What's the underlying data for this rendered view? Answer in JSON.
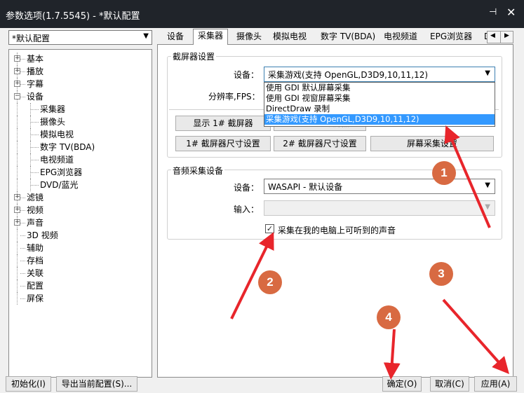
{
  "window": {
    "title": "参数选项(1.7.5545) - *默认配置",
    "pin_glyph": "⊣",
    "close_glyph": "✕"
  },
  "preset": {
    "value": "*默认配置"
  },
  "tree": [
    {
      "label": "基本",
      "expander": "+",
      "child": false
    },
    {
      "label": "播放",
      "expander": "+",
      "child": false
    },
    {
      "label": "字幕",
      "expander": "+",
      "child": false
    },
    {
      "label": "设备",
      "expander": "−",
      "child": false
    },
    {
      "label": "采集器",
      "expander": "",
      "child": true
    },
    {
      "label": "摄像头",
      "expander": "",
      "child": true
    },
    {
      "label": "模拟电视",
      "expander": "",
      "child": true
    },
    {
      "label": "数字 TV(BDA)",
      "expander": "",
      "child": true
    },
    {
      "label": "电视频道",
      "expander": "",
      "child": true
    },
    {
      "label": "EPG浏览器",
      "expander": "",
      "child": true
    },
    {
      "label": "DVD/蓝光",
      "expander": "",
      "child": true
    },
    {
      "label": "滤镜",
      "expander": "+",
      "child": false
    },
    {
      "label": "视频",
      "expander": "+",
      "child": false
    },
    {
      "label": "声音",
      "expander": "+",
      "child": false
    },
    {
      "label": "3D 视频",
      "expander": "",
      "child": false
    },
    {
      "label": "辅助",
      "expander": "",
      "child": false
    },
    {
      "label": "存档",
      "expander": "",
      "child": false
    },
    {
      "label": "关联",
      "expander": "",
      "child": false
    },
    {
      "label": "配置",
      "expander": "",
      "child": false
    },
    {
      "label": "屏保",
      "expander": "",
      "child": false
    }
  ],
  "tabs": [
    "设备",
    "采集器",
    "摄像头",
    "模拟电视",
    "数字 TV(BDA)",
    "电视频道",
    "EPG浏览器",
    "D"
  ],
  "tab_scroll": {
    "left": "◀",
    "right": "▶"
  },
  "screen": {
    "group_title": "截屏器设置",
    "device_label": "设备：",
    "device_value": "采集游戏(支持 OpenGL,D3D9,10,11,12)",
    "options": [
      "使用 GDI 默认屏幕采集",
      "使用 GDI 视窗屏幕采集",
      "DirectDraw 录制",
      "采集游戏(支持 OpenGL,D3D9,10,11,12)"
    ],
    "resolution_label": "分辨率,FPS：",
    "btn_show1": "显示 1# 截屏器",
    "btn_show2_partial": "显示 2# 截屏器",
    "btn_size1": "1# 截屏器尺寸设置",
    "btn_size2": "2# 截屏器尺寸设置",
    "btn_screen": "屏幕采集设置"
  },
  "audio": {
    "group_title": "音频采集设备",
    "device_label": "设备：",
    "device_value": "WASAPI - 默认设备",
    "input_label": "输入：",
    "input_value": "",
    "checkbox_label": "采集在我的电脑上可听到的声音",
    "checkbox_mark": "✓"
  },
  "footer": {
    "init": "初始化(I)",
    "export": "导出当前配置(S)...",
    "ok": "确定(O)",
    "cancel": "取消(C)",
    "apply": "应用(A)"
  },
  "annotations": [
    "1",
    "2",
    "3",
    "4"
  ],
  "colors": {
    "arrow": "#e8252b",
    "circle": "#d86a42",
    "selection": "#3399ff",
    "titlebar": "#20242a"
  }
}
